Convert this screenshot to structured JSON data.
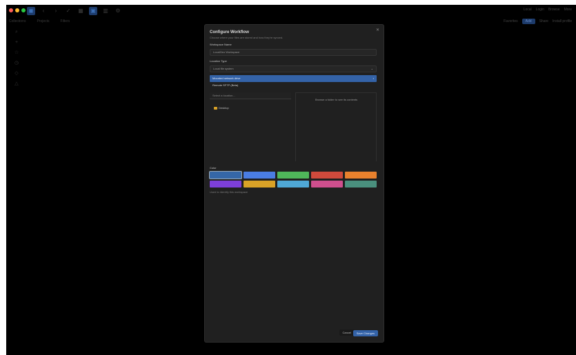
{
  "toolbar": {
    "right_items": [
      "Local",
      "Login",
      "Browse",
      "More"
    ]
  },
  "toolbar2": {
    "left_items": [
      "Collections",
      "Projects",
      "Filters"
    ],
    "right_items": [
      "Favorites",
      "Add",
      "Share",
      "Install profile"
    ]
  },
  "modal": {
    "title": "Configure Workflow",
    "subtitle": "Choose where your files are stored and how they're synced.",
    "close_label": "✕",
    "name_label": "Workspace Name",
    "name_value": "LocalGeo Workspace",
    "type_label": "Location Type",
    "type_current": "Local file system",
    "dropdown_selected": "Mounted network drive",
    "dropdown_option": "Remote SFTP (Beta)",
    "path_placeholder": "Select a location...",
    "right_pane_text": "Browse a folder to see its contents",
    "tree_item_label": "Desktop",
    "color_label": "Color",
    "color_hint": "Used to identify this workspace",
    "cancel_label": "Cancel",
    "save_label": "Save Changes"
  },
  "colors": {
    "swatches": [
      "#3567a8",
      "#4a7de3",
      "#4fb65a",
      "#cf4a3c",
      "#e9812d",
      "#7d3fd9",
      "#d9a227",
      "#4fa8d6",
      "#cf4f8e",
      "#4a907e"
    ],
    "traffic": [
      "#ff5f57",
      "#febc2e",
      "#28c840"
    ]
  }
}
